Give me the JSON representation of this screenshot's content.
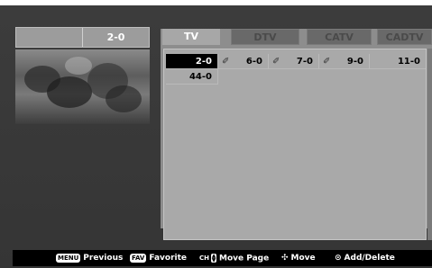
{
  "current_channel": "2-0",
  "tabs": [
    {
      "label": "TV",
      "active": true
    },
    {
      "label": "DTV",
      "active": false
    },
    {
      "label": "CATV",
      "active": false
    },
    {
      "label": "CADTV",
      "active": false
    }
  ],
  "channels": [
    {
      "number": "2-0",
      "selected": true,
      "locked": false
    },
    {
      "number": "6-0",
      "selected": false,
      "locked": true
    },
    {
      "number": "7-0",
      "selected": false,
      "locked": true
    },
    {
      "number": "9-0",
      "selected": false,
      "locked": true
    },
    {
      "number": "11-0",
      "selected": false,
      "locked": false
    },
    {
      "number": "44-0",
      "selected": false,
      "locked": false
    }
  ],
  "help": {
    "previous_key": "MENU",
    "previous_label": "Previous",
    "favorite_key": "FAV",
    "favorite_label": "Favorite",
    "movepage_key": "CH",
    "movepage_label": "Move Page",
    "move_label": "Move",
    "adddelete_label": "Add/Delete"
  },
  "icons": {
    "lock": "pencil-lock-icon",
    "move": "four-way-arrow-icon",
    "ok": "ok-circle-icon"
  }
}
